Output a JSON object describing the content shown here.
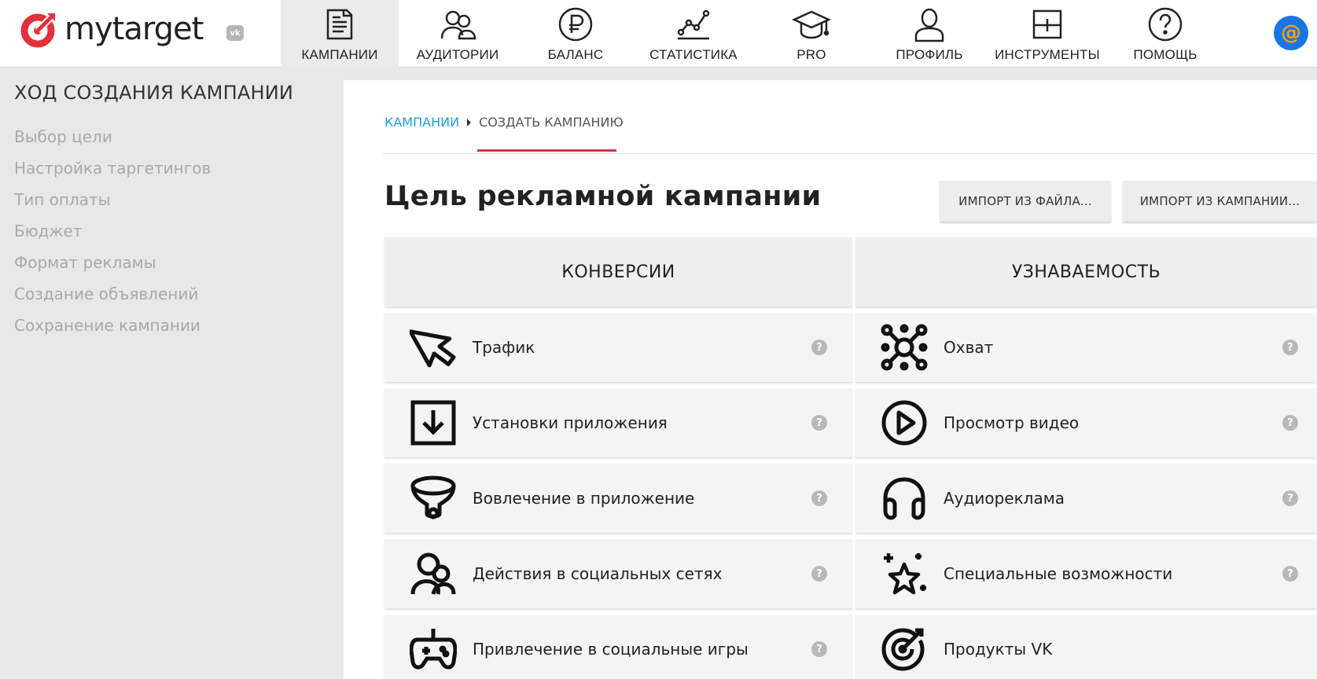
{
  "header": {
    "logo_text": "mytarget",
    "vk_badge": "vk",
    "avatar_symbol": "@",
    "nav": [
      {
        "label": "КАМПАНИИ",
        "icon": "campaign-document-icon",
        "active": true
      },
      {
        "label": "АУДИТОРИИ",
        "icon": "audience-people-icon",
        "active": false
      },
      {
        "label": "БАЛАНС",
        "icon": "ruble-coin-icon",
        "active": false
      },
      {
        "label": "СТАТИСТИКА",
        "icon": "line-chart-icon",
        "active": false
      },
      {
        "label": "PRO",
        "icon": "graduation-cap-icon",
        "active": false
      },
      {
        "label": "ПРОФИЛЬ",
        "icon": "profile-person-icon",
        "active": false
      },
      {
        "label": "ИНСТРУМЕНТЫ",
        "icon": "tools-window-icon",
        "active": false
      },
      {
        "label": "ПОМОЩЬ",
        "icon": "help-question-icon",
        "active": false
      }
    ]
  },
  "sidebar": {
    "title": "ХОД СОЗДАНИЯ КАМПАНИИ",
    "steps": [
      "Выбор цели",
      "Настройка таргетингов",
      "Тип оплаты",
      "Бюджет",
      "Формат рекламы",
      "Создание объявлений",
      "Сохранение кампании"
    ]
  },
  "breadcrumb": {
    "link": "КАМПАНИИ",
    "current": "СОЗДАТЬ КАМПАНИЮ"
  },
  "main": {
    "title": "Цель рекламной кампании",
    "import_file_button": "ИМПОРТ ИЗ ФАЙЛА...",
    "import_campaign_button": "ИМПОРТ ИЗ КАМПАНИИ...",
    "help_symbol": "?",
    "columns": [
      {
        "header": "КОНВЕРСИИ",
        "items": [
          {
            "label": "Трафик",
            "icon": "cursor-click-icon"
          },
          {
            "label": "Установки приложения",
            "icon": "download-box-icon"
          },
          {
            "label": "Вовлечение в приложение",
            "icon": "funnel-icon"
          },
          {
            "label": "Действия в социальных сетях",
            "icon": "social-people-icon"
          },
          {
            "label": "Привлечение в социальные игры",
            "icon": "gamepad-icon"
          }
        ]
      },
      {
        "header": "УЗНАВАЕМОСТЬ",
        "items": [
          {
            "label": "Охват",
            "icon": "reach-network-icon"
          },
          {
            "label": "Просмотр видео",
            "icon": "play-circle-icon"
          },
          {
            "label": "Аудиореклама",
            "icon": "headphones-icon"
          },
          {
            "label": "Специальные возможности",
            "icon": "stars-icon"
          },
          {
            "label": "Продукты VK",
            "icon": "target-arrow-icon"
          }
        ]
      }
    ]
  },
  "colors": {
    "brand_red": "#e4303a",
    "link_blue": "#1ea0d8",
    "avatar_blue": "#1776e4"
  }
}
